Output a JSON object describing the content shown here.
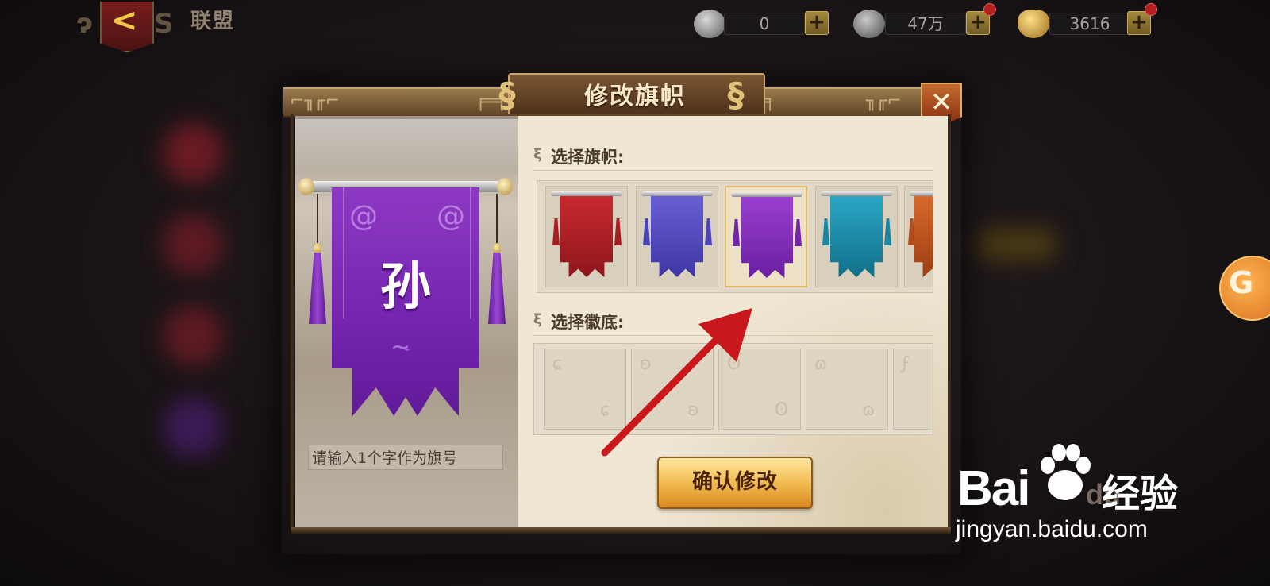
{
  "topbar": {
    "back_button": "<",
    "title": "联盟",
    "resources": [
      {
        "icon": "silver-coin-icon",
        "value": "0",
        "plus": "+",
        "has_dot": false
      },
      {
        "icon": "copper-coins-icon",
        "value": "47万",
        "plus": "+",
        "has_dot": true
      },
      {
        "icon": "gold-ingot-icon",
        "value": "3616",
        "plus": "+",
        "has_dot": true
      }
    ]
  },
  "dialog": {
    "title": "修改旗帜",
    "close_label": "✕",
    "banner_preview": {
      "character": "孙",
      "color": "#7e2fba"
    },
    "character_input": {
      "placeholder": "请输入1个字作为旗号"
    },
    "flag_section_label": "选择旗帜:",
    "flag_options": [
      {
        "color": "#b8232a",
        "selected": false
      },
      {
        "color": "#5b4fc4",
        "selected": false
      },
      {
        "color": "#8a2fc0",
        "selected": true
      },
      {
        "color": "#1f93b0",
        "selected": false
      },
      {
        "color": "#c65a24",
        "selected": false
      }
    ],
    "emblem_section_label": "选择徽底:",
    "emblem_options": [
      1,
      2,
      3,
      4,
      5
    ],
    "confirm_button": "确认修改"
  },
  "watermark": {
    "brand": "Bai",
    "brand_du": "du",
    "cn": "经验",
    "url": "jingyan.baidu.com"
  },
  "colors": {
    "accent_gold": "#f0b74a",
    "arrow_red": "#c8181c",
    "panel_bg": "#efe6d4"
  }
}
